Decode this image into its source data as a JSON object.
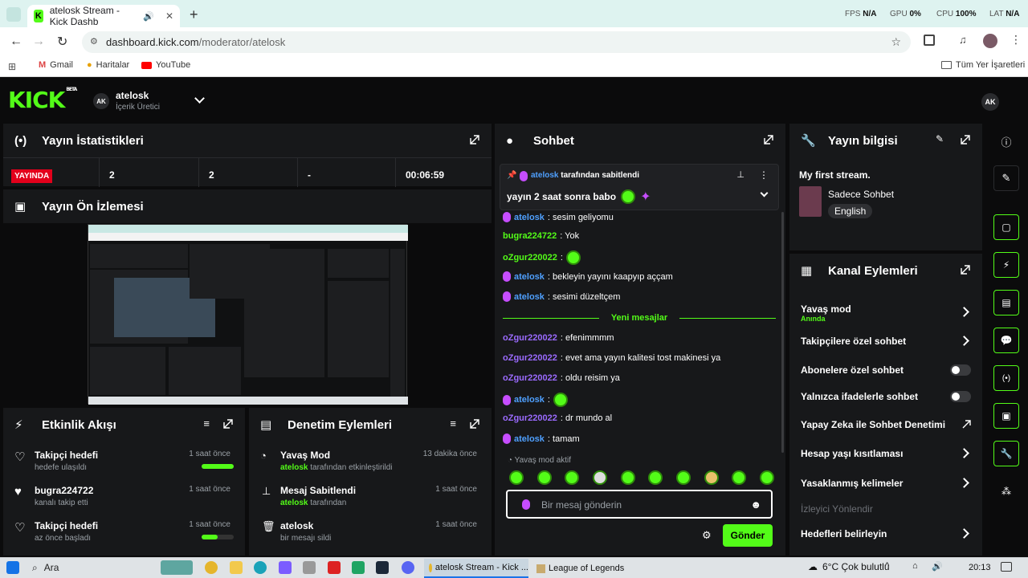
{
  "browser": {
    "tab_title": "atelosk Stream - Kick Dashb",
    "url_host": "dashboard.kick.com",
    "url_path": "/moderator/atelosk",
    "bookmarks": [
      "Gmail",
      "Haritalar",
      "YouTube"
    ],
    "all_bookmarks": "Tüm Yer İşaretleri",
    "sys": {
      "fps_label": "FPS",
      "fps": "N/A",
      "gpu_label": "GPU",
      "gpu": "0%",
      "cpu_label": "CPU",
      "cpu": "100%",
      "lat_label": "LAT",
      "lat": "N/A"
    }
  },
  "kick": {
    "logo": "KICK",
    "beta": "BETA",
    "user_initials": "AK",
    "username": "atelosk",
    "role": "İçerik Üretici"
  },
  "stats": {
    "title": "Yayın İstatistikleri",
    "live_badge": "YAYINDA",
    "viewers": "2",
    "followers": "2",
    "subs": "-",
    "duration": "00:06:59"
  },
  "preview": {
    "title": "Yayın Ön İzlemesi"
  },
  "activity": {
    "title": "Etkinlik Akışı",
    "items": [
      {
        "title": "Takipçi hedefi",
        "sub": "hedefe ulaşıldı",
        "time": "1 saat önce",
        "progress": 100
      },
      {
        "title": "bugra224722",
        "sub": "kanalı takip etti",
        "time": "1 saat önce"
      },
      {
        "title": "Takipçi hedefi",
        "sub": "az önce başladı",
        "time": "1 saat önce",
        "progress": 50
      }
    ]
  },
  "modlog": {
    "title": "Denetim Eylemleri",
    "items": [
      {
        "title": "Yavaş Mod",
        "user": "atelosk",
        "sub": "tarafından etkinleştirildi",
        "time": "13 dakika önce"
      },
      {
        "title": "Mesaj Sabitlendi",
        "user": "atelosk",
        "sub": "tarafından",
        "time": "1 saat önce"
      },
      {
        "title": "atelosk",
        "user": "",
        "sub": "bir mesajı sildi",
        "time": "1 saat önce"
      }
    ]
  },
  "chat": {
    "title": "Sohbet",
    "pinned_by_user": "atelosk",
    "pinned_by_text": "tarafından sabitlendi",
    "pinned_msg": "yayın 2 saat sonra babo",
    "messages_before": [
      {
        "user": "atelosk",
        "text": ": sesim geliyomu"
      },
      {
        "user": "bugra224722",
        "text": ": Yok"
      },
      {
        "user": "oZgur220022",
        "text": ":"
      },
      {
        "user": "atelosk",
        "text": ": bekleyin yayını kaapyıp aççam"
      },
      {
        "user": "atelosk",
        "text": ": sesimi düzeltçem"
      }
    ],
    "new_messages": "Yeni mesajlar",
    "messages_after": [
      {
        "user": "oZgur220022",
        "text": ": efenimmmm"
      },
      {
        "user": "oZgur220022",
        "text": ": evet ama yayın kalitesi tost makinesi ya"
      },
      {
        "user": "oZgur220022",
        "text": ": oldu reisim ya"
      },
      {
        "user": "atelosk",
        "text": ":"
      },
      {
        "user": "oZgur220022",
        "text": ": dr mundo al"
      },
      {
        "user": "atelosk",
        "text": ": tamam"
      }
    ],
    "slow_mode": "Yavaş mod aktif",
    "placeholder": "Bir mesaj gönderin",
    "send": "Gönder"
  },
  "info": {
    "title": "Yayın bilgisi",
    "stream_title": "My first stream.",
    "category": "Sadece Sohbet",
    "language": "English"
  },
  "actions": {
    "title": "Kanal Eylemleri",
    "slow_mode": "Yavaş mod",
    "slow_mode_value": "Anında",
    "followers_only": "Takipçilere özel sohbet",
    "subs_only": "Abonelere özel sohbet",
    "emotes_only": "Yalnızca ifadelerle sohbet",
    "ai_mod": "Yapay Zeka ile Sohbet Denetimi",
    "account_age": "Hesap yaşı kısıtlaması",
    "banned_words": "Yasaklanmış kelimeler",
    "redirect": "İzleyici Yönlendir",
    "goals": "Hedefleri belirleyin"
  },
  "taskbar": {
    "search": "Ara",
    "app1": "atelosk Stream - Kick ...",
    "app2": "League of Legends",
    "weather": "6°C  Çok bulutlu",
    "time": "20:13"
  }
}
